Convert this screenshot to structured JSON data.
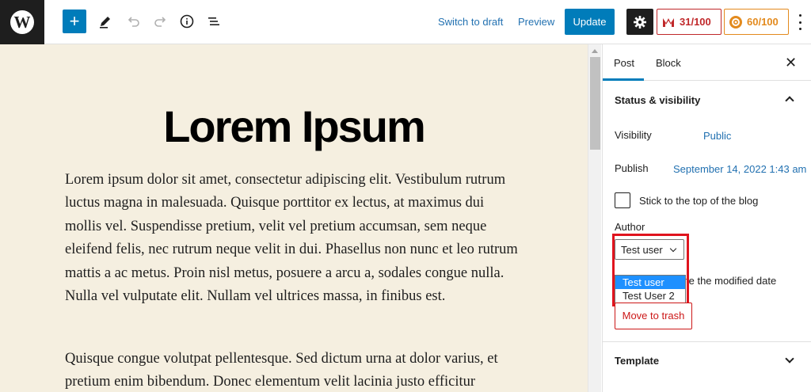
{
  "toolbar": {
    "logo_letter": "W",
    "add_symbol": "+",
    "icons": [
      "wordpress-logo-icon",
      "plus-icon",
      "pencil-icon",
      "undo-icon",
      "redo-icon",
      "info-icon",
      "list-view-icon",
      "gear-icon",
      "seo-score-icon",
      "readability-score-icon",
      "more-options-icon"
    ],
    "switch_to_draft": "Switch to draft",
    "preview": "Preview",
    "update": "Update",
    "seo_score": "31/100",
    "readability_score": "60/100",
    "colors": {
      "primary": "#007cba",
      "seo": "#c0282a",
      "readability": "#e38a1d"
    }
  },
  "editor": {
    "title": "Lorem Ipsum",
    "paragraphs": [
      "Lorem ipsum dolor sit amet, consectetur adipiscing elit. Vestibulum rutrum luctus magna in malesuada. Quisque porttitor ex lectus, at maximus dui mollis vel. Suspendisse pretium, velit vel pretium accumsan, sem neque eleifend felis, nec rutrum neque velit in dui. Phasellus non nunc et leo rutrum mattis a ac metus. Proin nisl metus, posuere a arcu a, sodales congue nulla. Nulla vel vulputate elit. Nullam vel ultrices massa, in finibus est.",
      "Quisque congue volutpat pellentesque. Sed dictum urna at dolor varius, et pretium enim bibendum. Donec elementum velit lacinia justo efficitur"
    ],
    "background": "#f5efe0"
  },
  "sidebar": {
    "tabs": [
      {
        "label": "Post",
        "active": true
      },
      {
        "label": "Block",
        "active": false
      }
    ],
    "close_symbol": "✕",
    "status_panel": {
      "title": "Status & visibility",
      "visibility_label": "Visibility",
      "visibility_value": "Public",
      "publish_label": "Publish",
      "publish_value": "September 14, 2022 1:43 am",
      "sticky_label": "Stick to the top of the blog",
      "sticky_checked": false,
      "author_label": "Author",
      "author_selected": "Test user",
      "author_options": [
        "Test user",
        "Test User 2"
      ],
      "modified_partial": "te the modified date",
      "trash_label": "Move to trash"
    },
    "template_panel": {
      "title": "Template"
    }
  }
}
